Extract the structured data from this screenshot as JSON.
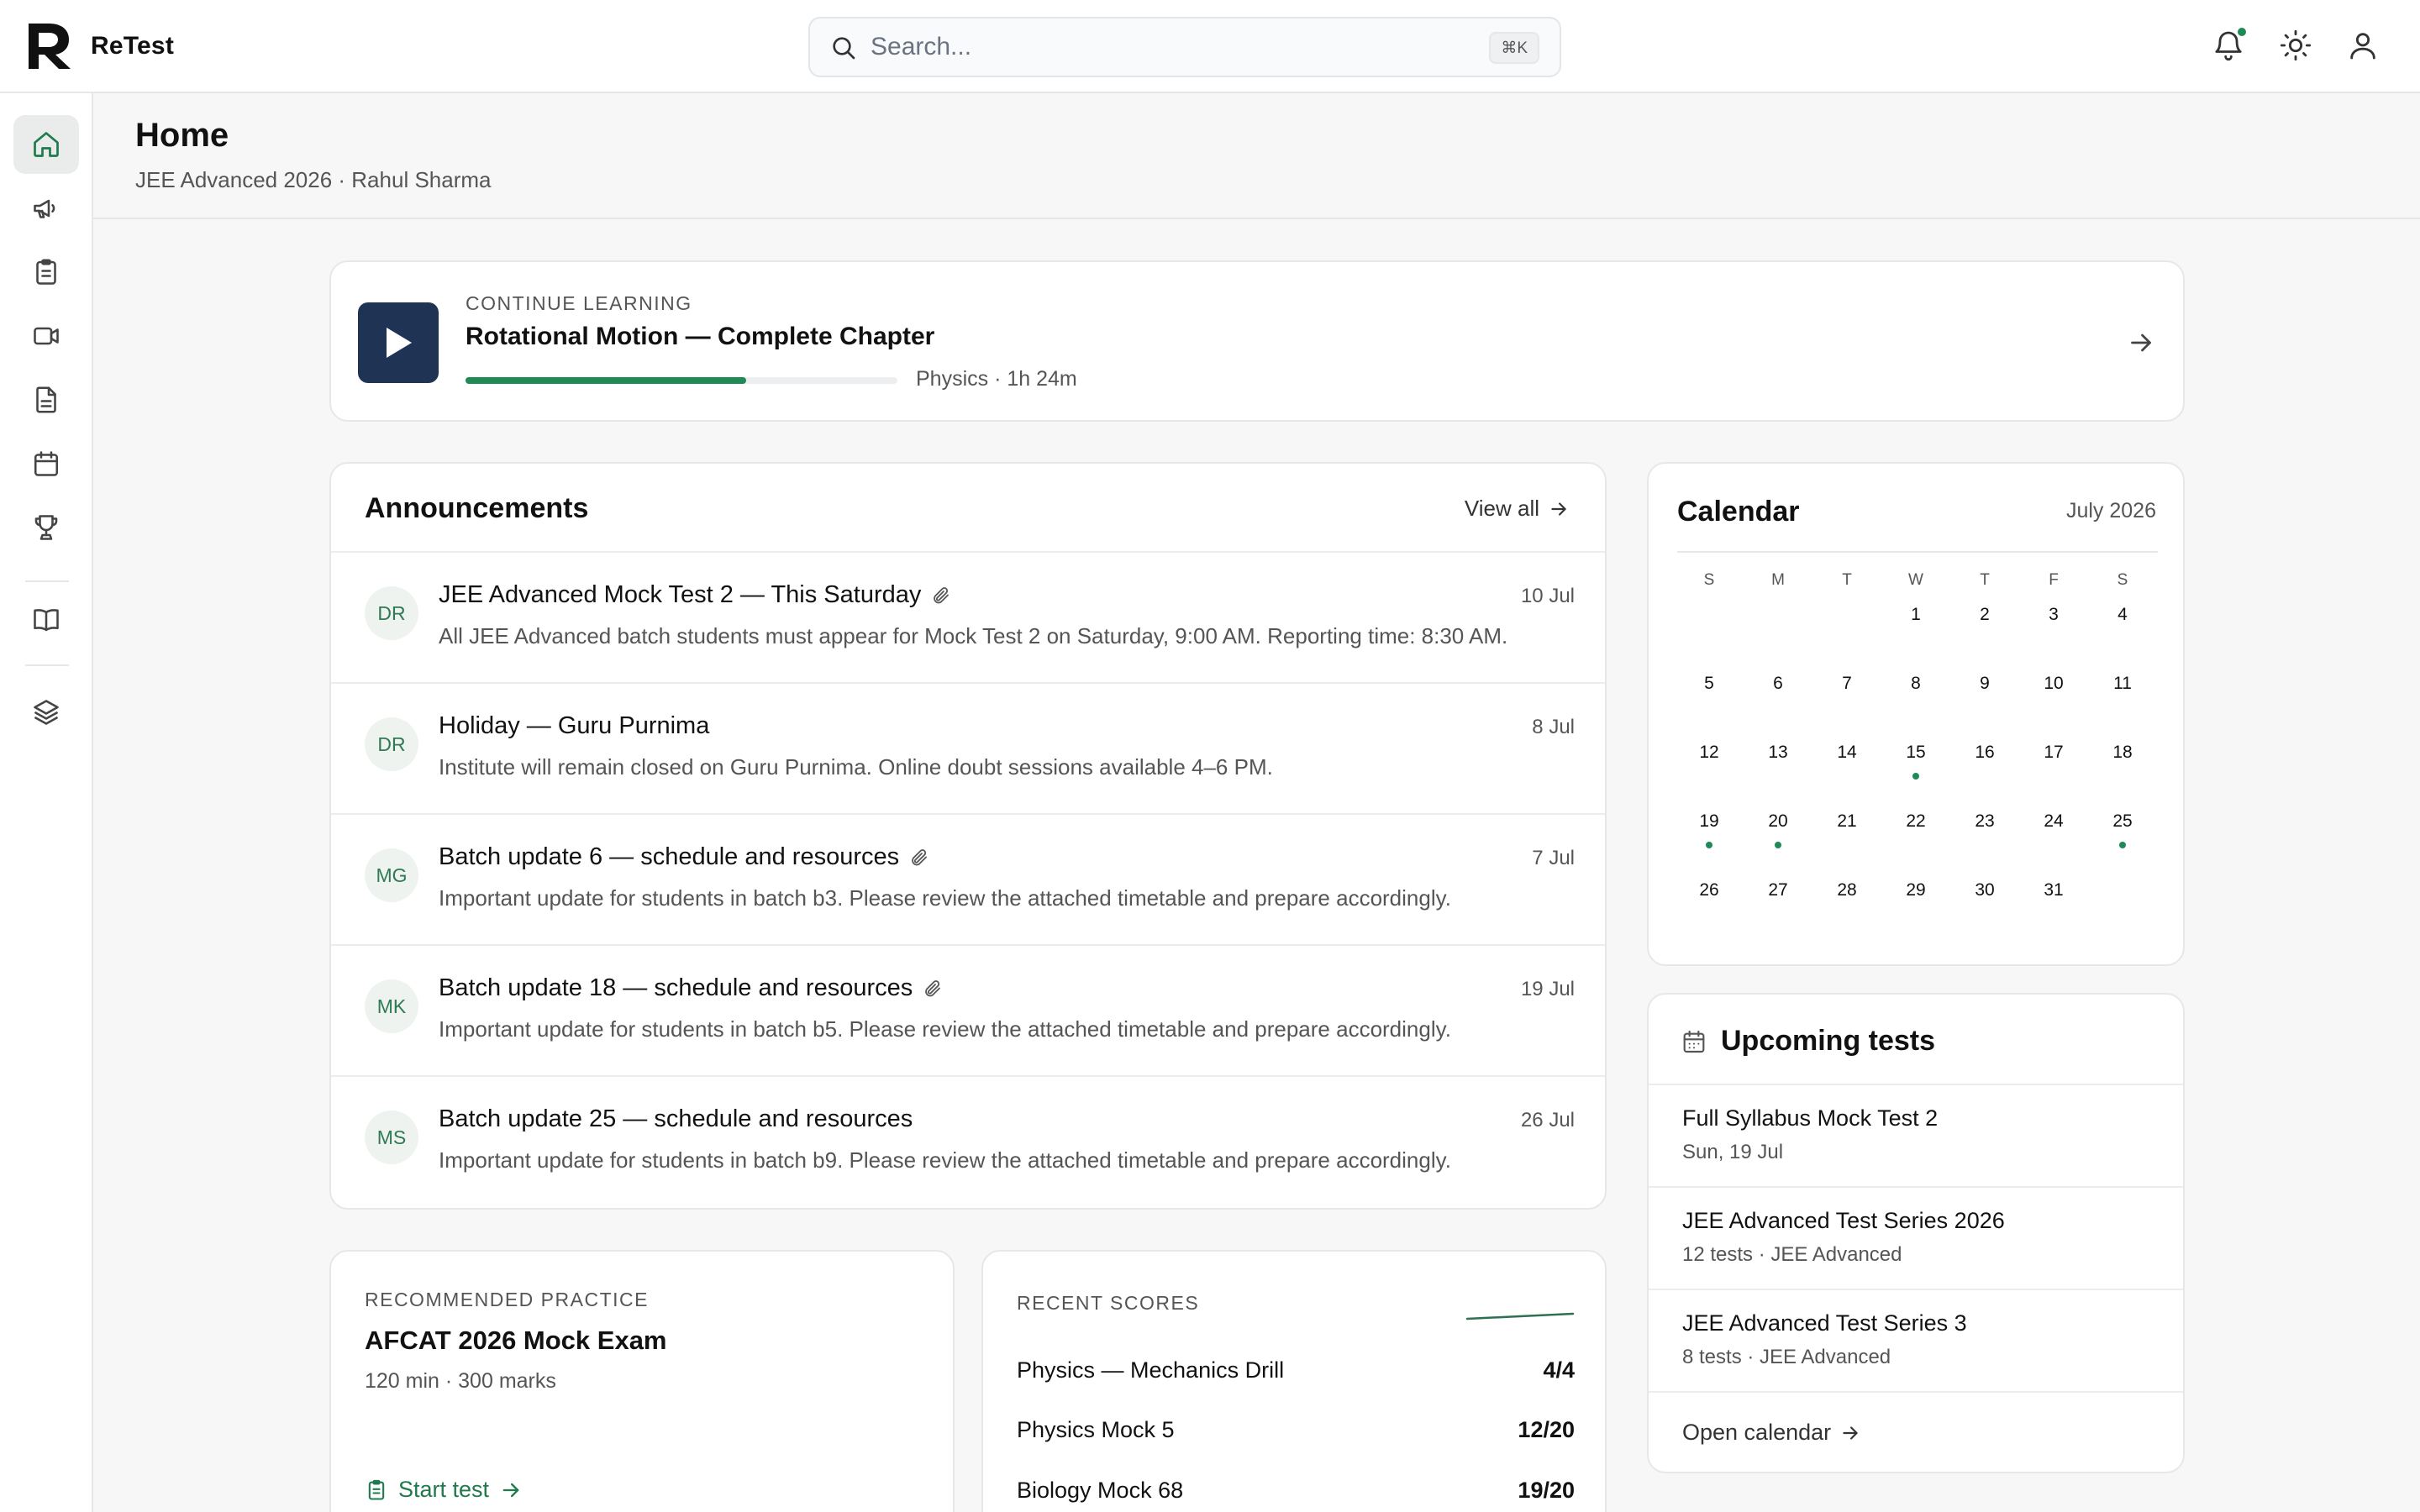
{
  "app": {
    "name": "ReTest"
  },
  "search": {
    "placeholder": "Search...",
    "shortcut": "⌘K"
  },
  "header": {
    "title": "Home",
    "subtitle": "JEE Advanced 2026 · Rahul Sharma"
  },
  "sidebar": {
    "items": [
      {
        "name": "home",
        "icon": "home-icon",
        "active": true
      },
      {
        "name": "announcements",
        "icon": "megaphone-icon"
      },
      {
        "name": "tests",
        "icon": "clipboard-icon"
      },
      {
        "name": "videos",
        "icon": "video-icon"
      },
      {
        "name": "documents",
        "icon": "document-icon"
      },
      {
        "name": "calendar",
        "icon": "calendar-icon"
      },
      {
        "name": "leaderboard",
        "icon": "trophy-icon"
      },
      {
        "name": "library",
        "icon": "book-icon"
      },
      {
        "name": "layers",
        "icon": "layers-icon"
      }
    ]
  },
  "continue_learning": {
    "kicker": "CONTINUE LEARNING",
    "title": "Rotational Motion — Complete Chapter",
    "meta": "Physics · 1h 24m",
    "progress_percent": 65
  },
  "announcements": {
    "title": "Announcements",
    "view_all": "View all",
    "items": [
      {
        "initials": "DR",
        "title": "JEE Advanced Mock Test 2 — This Saturday",
        "attachment": true,
        "date": "10 Jul",
        "body": "All JEE Advanced batch students must appear for Mock Test 2 on Saturday, 9:00 AM. Reporting time: 8:30 AM."
      },
      {
        "initials": "DR",
        "title": "Holiday — Guru Purnima",
        "attachment": false,
        "date": "8 Jul",
        "body": "Institute will remain closed on Guru Purnima. Online doubt sessions available 4–6 PM."
      },
      {
        "initials": "MG",
        "title": "Batch update 6 — schedule and resources",
        "attachment": true,
        "date": "7 Jul",
        "body": "Important update for students in batch b3. Please review the attached timetable and prepare accordingly."
      },
      {
        "initials": "MK",
        "title": "Batch update 18 — schedule and resources",
        "attachment": true,
        "date": "19 Jul",
        "body": "Important update for students in batch b5. Please review the attached timetable and prepare accordingly."
      },
      {
        "initials": "MS",
        "title": "Batch update 25 — schedule and resources",
        "attachment": false,
        "date": "26 Jul",
        "body": "Important update for students in batch b9. Please review the attached timetable and prepare accordingly."
      }
    ]
  },
  "calendar": {
    "title": "Calendar",
    "month": "July 2026",
    "weekdays": [
      "S",
      "M",
      "T",
      "W",
      "T",
      "F",
      "S"
    ],
    "first_weekday": 3,
    "days_in_month": 31,
    "event_days": [
      15,
      19,
      20,
      25
    ]
  },
  "upcoming": {
    "title": "Upcoming tests",
    "items": [
      {
        "name": "Full Syllabus Mock Test 2",
        "meta": "Sun, 19 Jul"
      },
      {
        "name": "JEE Advanced Test Series 2026",
        "meta": "12 tests · JEE Advanced"
      },
      {
        "name": "JEE Advanced Test Series 3",
        "meta": "8 tests · JEE Advanced"
      }
    ],
    "open_calendar": "Open calendar"
  },
  "recommended": {
    "kicker": "RECOMMENDED PRACTICE",
    "title": "AFCAT 2026 Mock Exam",
    "meta": "120 min · 300 marks",
    "start_label": "Start test"
  },
  "recent_scores": {
    "kicker": "RECENT SCORES",
    "items": [
      {
        "name": "Physics — Mechanics Drill",
        "score": "4/4"
      },
      {
        "name": "Physics Mock 5",
        "score": "12/20"
      },
      {
        "name": "Biology Mock 68",
        "score": "19/20"
      }
    ]
  },
  "colors": {
    "accent": "#1f8a55",
    "primary_dark": "#1f3455",
    "text": "#111111",
    "muted": "#555555"
  }
}
